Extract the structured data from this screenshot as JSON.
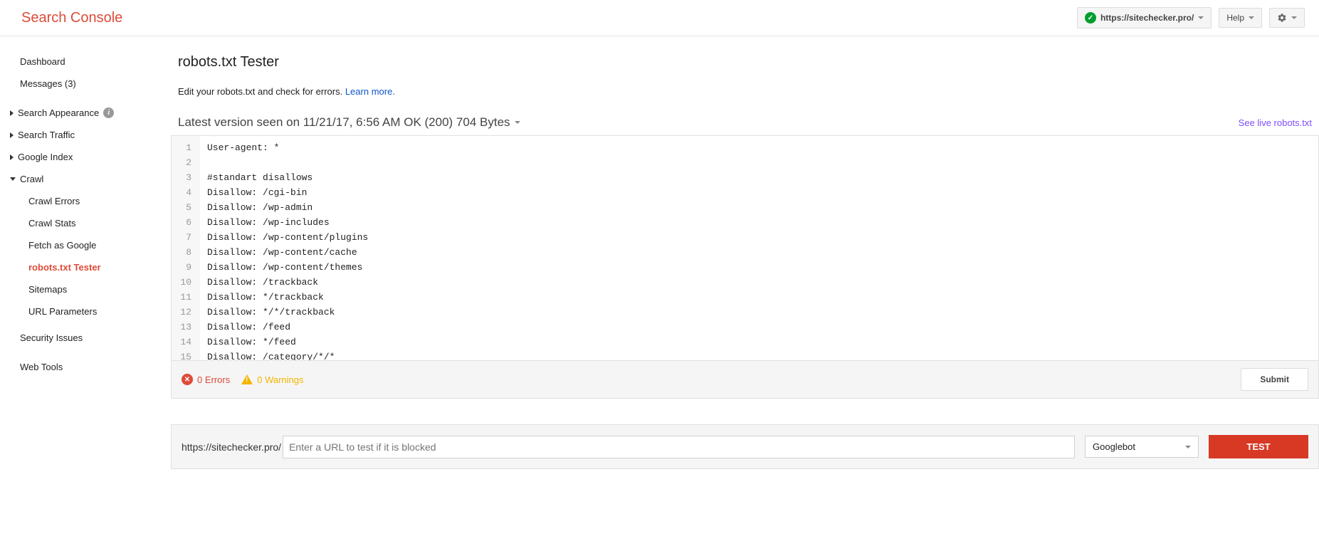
{
  "brand": "Search Console",
  "header": {
    "property": "https://sitechecker.pro/",
    "help_label": "Help"
  },
  "sidebar": {
    "dashboard": "Dashboard",
    "messages": "Messages (3)",
    "search_appearance": "Search Appearance",
    "search_traffic": "Search Traffic",
    "google_index": "Google Index",
    "crawl": "Crawl",
    "crawl_items": {
      "errors": "Crawl Errors",
      "stats": "Crawl Stats",
      "fetch": "Fetch as Google",
      "robots": "robots.txt Tester",
      "sitemaps": "Sitemaps",
      "url_params": "URL Parameters"
    },
    "security": "Security Issues",
    "web_tools": "Web Tools"
  },
  "main": {
    "title": "robots.txt Tester",
    "subtitle_prefix": "Edit your robots.txt and check for errors. ",
    "learn_more": "Learn more.",
    "version_text": "Latest version seen on 11/21/17, 6:56 AM OK (200) 704 Bytes",
    "live_link": "See live robots.txt",
    "code_lines": [
      "User-agent: *",
      "",
      "#standart disallows",
      "Disallow: /cgi-bin",
      "Disallow: /wp-admin",
      "Disallow: /wp-includes",
      "Disallow: /wp-content/plugins",
      "Disallow: /wp-content/cache",
      "Disallow: /wp-content/themes",
      "Disallow: /trackback",
      "Disallow: */trackback",
      "Disallow: */*/trackback",
      "Disallow: /feed",
      "Disallow: */feed",
      "Disallow: /category/*/*"
    ],
    "errors_text": "0 Errors",
    "warnings_text": "0 Warnings",
    "submit_label": "Submit",
    "url_prefix": "https://sitechecker.pro/",
    "url_placeholder": "Enter a URL to test if it is blocked",
    "bot_label": "Googlebot",
    "test_label": "TEST"
  }
}
